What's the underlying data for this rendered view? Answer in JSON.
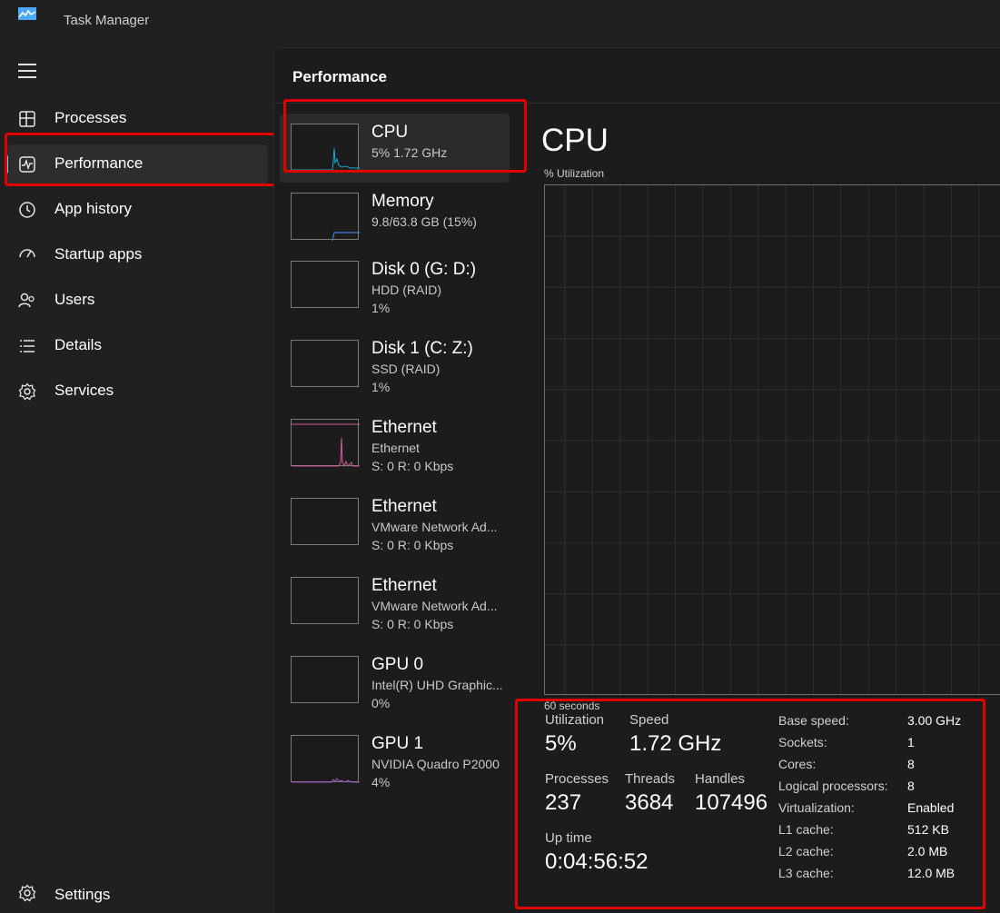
{
  "window": {
    "title": "Task Manager"
  },
  "sidebar": {
    "items": [
      {
        "label": "Processes",
        "icon": "processes-icon"
      },
      {
        "label": "Performance",
        "icon": "performance-icon",
        "active": true
      },
      {
        "label": "App history",
        "icon": "app-history-icon"
      },
      {
        "label": "Startup apps",
        "icon": "startup-apps-icon"
      },
      {
        "label": "Users",
        "icon": "users-icon"
      },
      {
        "label": "Details",
        "icon": "details-icon"
      },
      {
        "label": "Services",
        "icon": "services-icon"
      }
    ],
    "settings_label": "Settings"
  },
  "page": {
    "title": "Performance"
  },
  "devices": [
    {
      "name": "CPU",
      "sub1": "5%  1.72 GHz",
      "sub2": "",
      "color": "#17a9d6"
    },
    {
      "name": "Memory",
      "sub1": "9.8/63.8 GB (15%)",
      "sub2": "",
      "color": "#3c7ddc"
    },
    {
      "name": "Disk 0 (G: D:)",
      "sub1": "HDD (RAID)",
      "sub2": "1%",
      "color": "#4ea64e"
    },
    {
      "name": "Disk 1 (C: Z:)",
      "sub1": "SSD (RAID)",
      "sub2": "1%",
      "color": "#4ea64e"
    },
    {
      "name": "Ethernet",
      "sub1": "Ethernet",
      "sub2": "S: 0 R: 0 Kbps",
      "color": "#d45a9a"
    },
    {
      "name": "Ethernet",
      "sub1": "VMware Network Ad...",
      "sub2": "S: 0 R: 0 Kbps",
      "color": "#d45a9a"
    },
    {
      "name": "Ethernet",
      "sub1": "VMware Network Ad...",
      "sub2": "S: 0 R: 0 Kbps",
      "color": "#d45a9a"
    },
    {
      "name": "GPU 0",
      "sub1": "Intel(R) UHD Graphic...",
      "sub2": "0%",
      "color": "#a64ec8"
    },
    {
      "name": "GPU 1",
      "sub1": "NVIDIA Quadro P2000",
      "sub2": "4%",
      "color": "#a64ec8"
    }
  ],
  "detail": {
    "title": "CPU",
    "graph_label": "% Utilization",
    "graph_seconds": "60 seconds",
    "utilization_label": "Utilization",
    "utilization_value": "5%",
    "speed_label": "Speed",
    "speed_value": "1.72 GHz",
    "processes_label": "Processes",
    "processes_value": "237",
    "threads_label": "Threads",
    "threads_value": "3684",
    "handles_label": "Handles",
    "handles_value": "107496",
    "uptime_label": "Up time",
    "uptime_value": "0:04:56:52",
    "specs": [
      {
        "key": "Base speed:",
        "value": "3.00 GHz"
      },
      {
        "key": "Sockets:",
        "value": "1"
      },
      {
        "key": "Cores:",
        "value": "8"
      },
      {
        "key": "Logical processors:",
        "value": "8"
      },
      {
        "key": "Virtualization:",
        "value": "Enabled"
      },
      {
        "key": "L1 cache:",
        "value": "512 KB"
      },
      {
        "key": "L2 cache:",
        "value": "2.0 MB"
      },
      {
        "key": "L3 cache:",
        "value": "12.0 MB"
      }
    ]
  },
  "colors": {
    "accent": "#60cdff",
    "highlight": "#e00000",
    "graph_grid": "#2f2f2f"
  }
}
